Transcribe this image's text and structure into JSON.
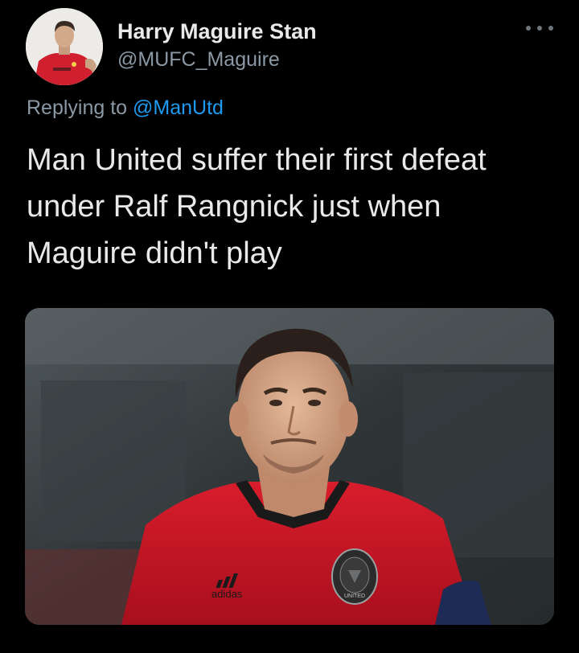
{
  "tweet": {
    "display_name": "Harry Maguire Stan",
    "handle": "@MUFC_Maguire",
    "replying_prefix": "Replying to",
    "replying_to": "@ManUtd",
    "text_lines": [
      "Man United suffer their first defeat",
      "under Ralf Rangnick just when",
      "Maguire didn't play"
    ]
  },
  "media": {
    "kit_brand": "adidas",
    "badge_text": "UNITED"
  },
  "icons": {
    "more": "more-horizontal-icon"
  },
  "colors": {
    "background": "#000000",
    "primary_text": "#e7e9ea",
    "secondary_text": "#8b98a5",
    "link": "#1d9bf0",
    "shirt_red": "#c8102e"
  }
}
